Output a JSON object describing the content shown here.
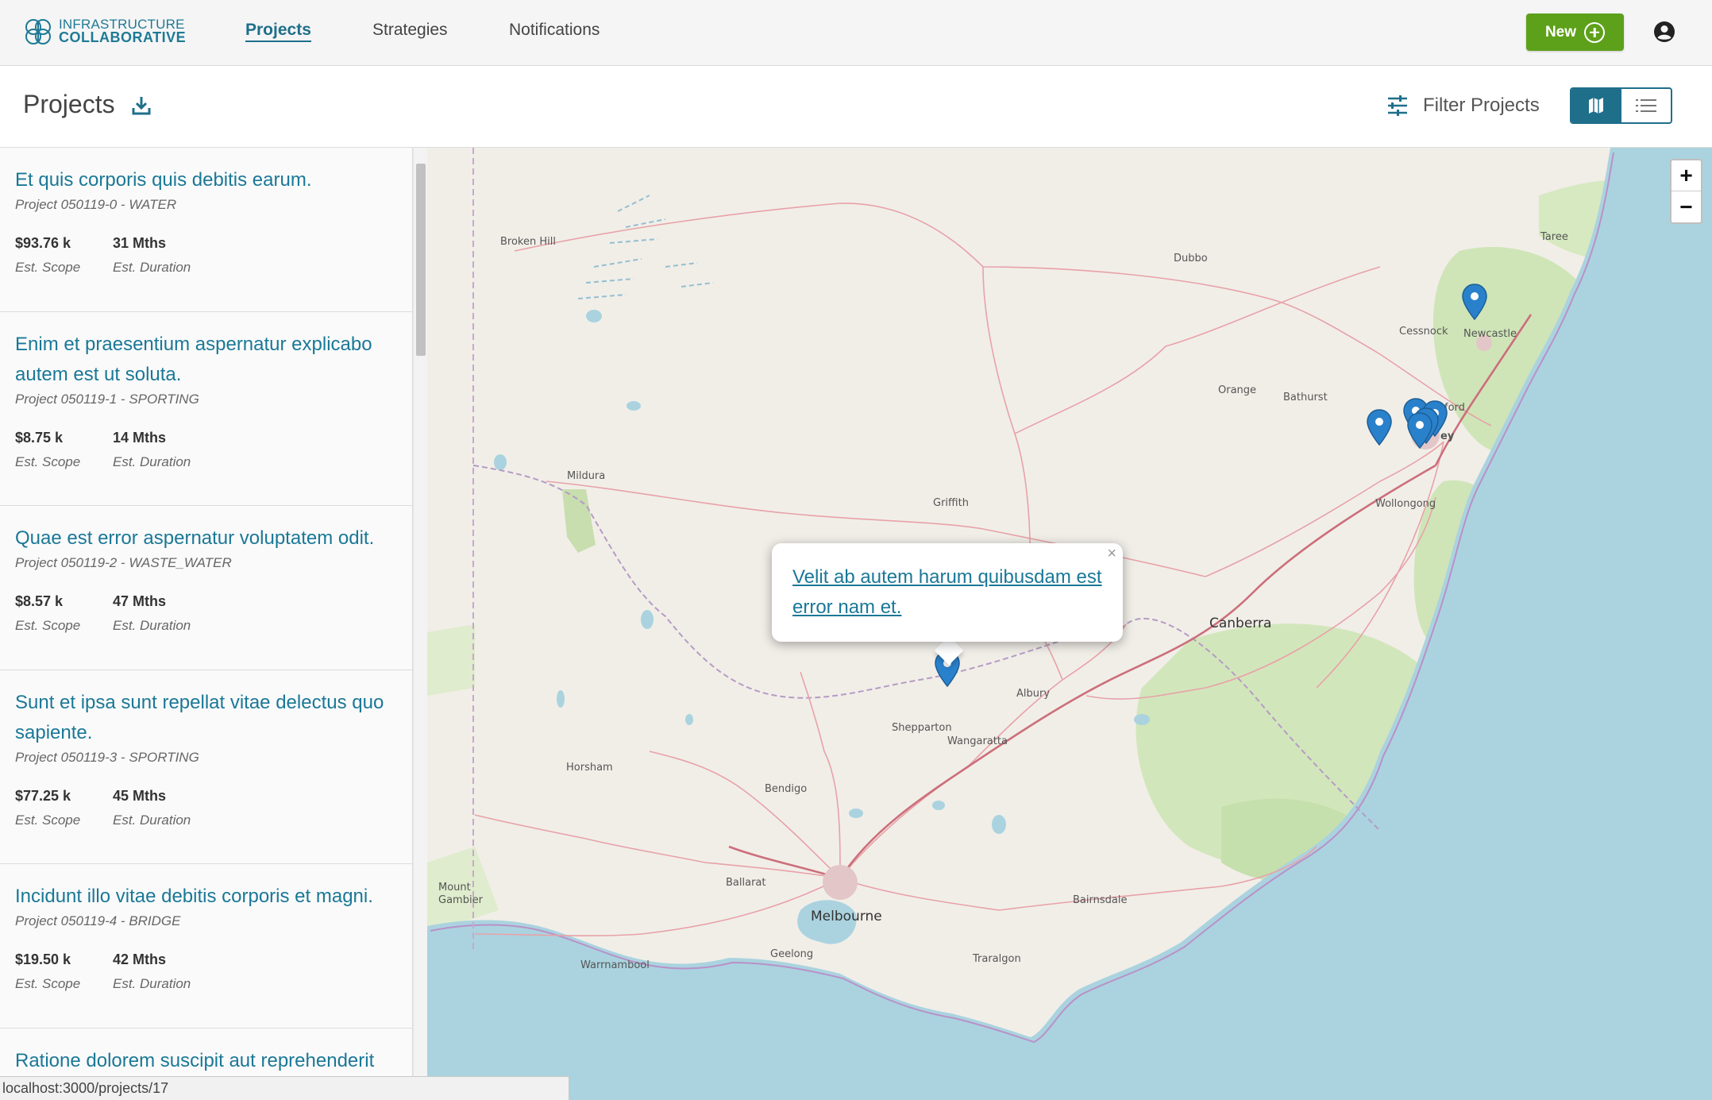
{
  "app": {
    "logo_line1": "INFRASTRUCTURE",
    "logo_line2": "COLLABORATIVE",
    "nav": [
      {
        "label": "Projects",
        "active": true
      },
      {
        "label": "Strategies",
        "active": false
      },
      {
        "label": "Notifications",
        "active": false
      }
    ],
    "new_button": "New"
  },
  "header": {
    "title": "Projects",
    "filter_label": "Filter Projects",
    "view_mode": "map"
  },
  "projects": [
    {
      "title": "Et quis corporis quis debitis earum.",
      "subtitle": "Project 050119-0 - WATER",
      "scope": "$93.76 k",
      "scope_label": "Est. Scope",
      "duration": "31 Mths",
      "duration_label": "Est. Duration"
    },
    {
      "title": "Enim et praesentium aspernatur explicabo autem est ut soluta.",
      "subtitle": "Project 050119-1 - SPORTING",
      "scope": "$8.75 k",
      "scope_label": "Est. Scope",
      "duration": "14 Mths",
      "duration_label": "Est. Duration"
    },
    {
      "title": "Quae est error aspernatur voluptatem odit.",
      "subtitle": "Project 050119-2 - WASTE_WATER",
      "scope": "$8.57 k",
      "scope_label": "Est. Scope",
      "duration": "47 Mths",
      "duration_label": "Est. Duration"
    },
    {
      "title": "Sunt et ipsa sunt repellat vitae delectus quo sapiente.",
      "subtitle": "Project 050119-3 - SPORTING",
      "scope": "$77.25 k",
      "scope_label": "Est. Scope",
      "duration": "45 Mths",
      "duration_label": "Est. Duration"
    },
    {
      "title": "Incidunt illo vitae debitis corporis et magni.",
      "subtitle": "Project 050119-4 - BRIDGE",
      "scope": "$19.50 k",
      "scope_label": "Est. Scope",
      "duration": "42 Mths",
      "duration_label": "Est. Duration"
    },
    {
      "title": "Ratione dolorem suscipit aut reprehenderit",
      "subtitle": "",
      "scope": "",
      "scope_label": "",
      "duration": "",
      "duration_label": ""
    }
  ],
  "map": {
    "popup_text": "Velit ab autem harum quibusdam est error nam et.",
    "popup_close": "×",
    "zoom_in": "+",
    "zoom_out": "−",
    "cities": [
      "Broken Hill",
      "Dubbo",
      "Taree",
      "Cessnock",
      "Newcastle",
      "Orange",
      "Bathurst",
      "ford",
      "ey",
      "Mildura",
      "Griffith",
      "Wollongong",
      "Canberra",
      "Albury",
      "Shepparton",
      "Wangaratta",
      "Horsham",
      "Bendigo",
      "Ballarat",
      "Mount Gambier",
      "Melbourne",
      "Bairnsdale",
      "Geelong",
      "Traralgon",
      "Warrnambool"
    ]
  },
  "status_url": "localhost:3000/projects/17",
  "colors": {
    "accent": "#1f6f8b",
    "new_button": "#5da11a",
    "link": "#1a7897",
    "water": "#aad3df",
    "land": "#f1eee8",
    "forest": "#cfe5b8",
    "marker": "#2a81cb"
  }
}
